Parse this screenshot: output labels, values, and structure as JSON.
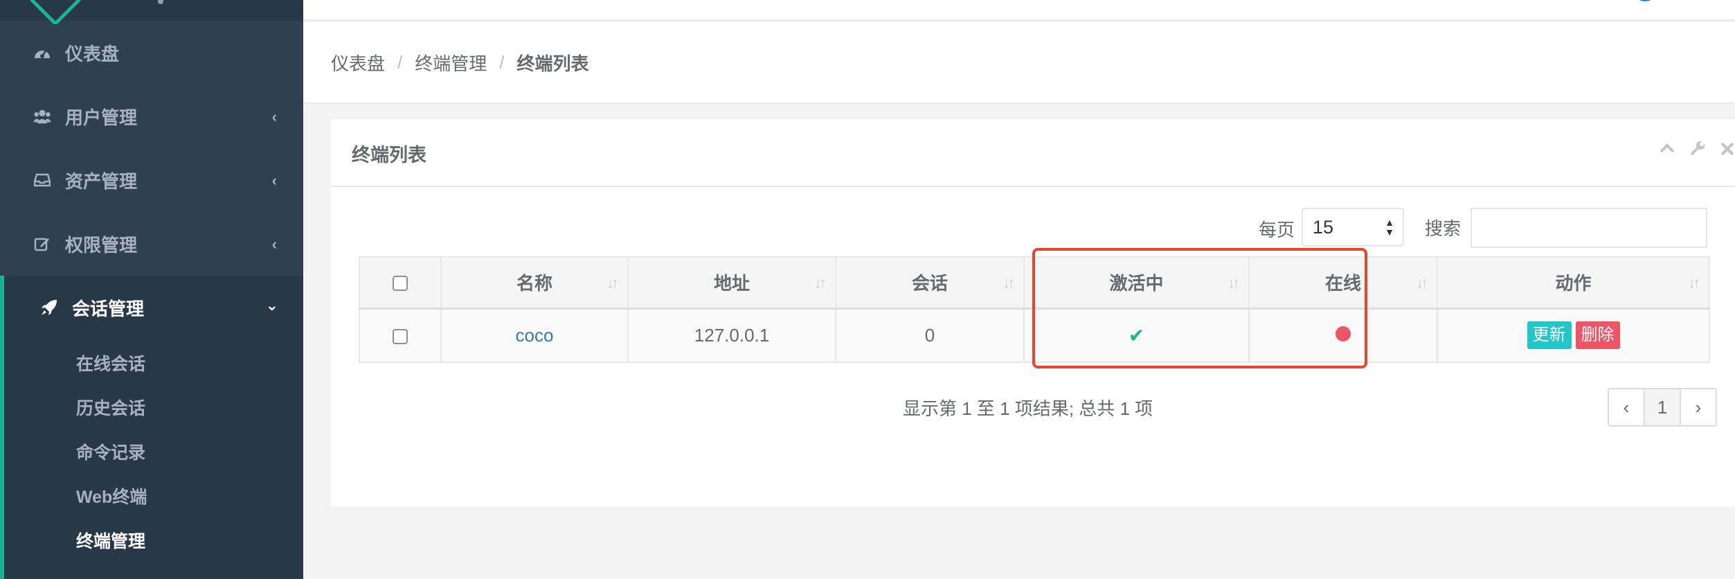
{
  "sidebar": {
    "items": [
      {
        "label": "仪表盘",
        "icon": "dashboard-icon"
      },
      {
        "label": "用户管理",
        "icon": "users-icon"
      },
      {
        "label": "资产管理",
        "icon": "inbox-icon"
      },
      {
        "label": "权限管理",
        "icon": "edit-icon"
      }
    ],
    "active": {
      "label": "会话管理",
      "icon": "rocket-icon",
      "children": [
        "在线会话",
        "历史会话",
        "命令记录",
        "Web终端",
        "终端管理"
      ]
    }
  },
  "breadcrumb": [
    "仪表盘",
    "终端管理",
    "终端列表"
  ],
  "breadcrumb_sep": "/",
  "panel": {
    "title": "终端列表",
    "per_page_label": "每页",
    "per_page_value": "15",
    "search_label": "搜索",
    "search_value": ""
  },
  "table": {
    "columns": [
      "名称",
      "地址",
      "会话",
      "激活中",
      "在线",
      "动作"
    ],
    "rows": [
      {
        "name": "coco",
        "address": "127.0.0.1",
        "sessions": "0",
        "active": true,
        "online": false,
        "actions": [
          "更新",
          "删除"
        ]
      }
    ]
  },
  "footer": {
    "info": "显示第 1 至 1 项结果; 总共 1 项",
    "pagination": {
      "prev": "‹",
      "current": "1",
      "next": "›"
    }
  },
  "colors": {
    "accent": "#1ab394",
    "sidebar": "#2f4050",
    "danger": "#ed5565",
    "info": "#23c6c8",
    "highlight": "#e8452c"
  }
}
